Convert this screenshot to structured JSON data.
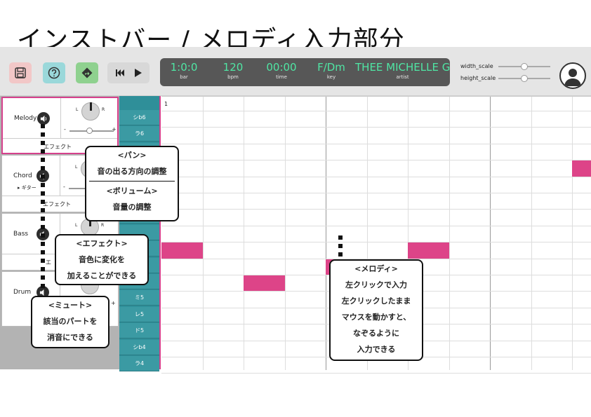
{
  "heading": "インストバー / メロディ入力部分",
  "toolbar": {
    "save_icon": "save-icon",
    "help_icon": "help-icon",
    "share_icon": "share-icon",
    "display": {
      "bar": {
        "value": "1:0:0",
        "label": "bar"
      },
      "bpm": {
        "value": "120",
        "label": "bpm"
      },
      "time": {
        "value": "00:00",
        "label": "time"
      },
      "key": {
        "value": "F/Dm",
        "label": "key"
      },
      "artist": {
        "value": "THEE MICHELLE G",
        "label": "artist"
      }
    },
    "width_scale": {
      "label": "width_scale",
      "value": 0.5
    },
    "height_scale": {
      "label": "height_scale",
      "value": 0.5
    }
  },
  "tracks": [
    {
      "name": "Melody",
      "pan_left": "L",
      "pan_right": "R",
      "minus": "-",
      "plus": "+",
      "effect": "エフェクト",
      "selected": true
    },
    {
      "name": "Chord",
      "instrument": "▸ ギター",
      "pan_left": "L",
      "minus": "-",
      "effect": "エフェクト"
    },
    {
      "name": "Bass",
      "pan_left": "L",
      "pan_right": "R",
      "effect": "エ"
    },
    {
      "name": "Drum",
      "plus": "+"
    }
  ],
  "keys": [
    "シb6",
    "ラ6",
    "",
    "",
    "",
    "",
    "",
    "",
    "",
    "",
    "",
    "ミ5",
    "レ5",
    "ド5",
    "シb4",
    "ラ4"
  ],
  "grid": {
    "bar_label": "1"
  },
  "callouts": {
    "pan": {
      "title": "<パン>",
      "lines": [
        "音の出る方向の調整"
      ]
    },
    "volume": {
      "title": "<ボリューム>",
      "lines": [
        "音量の調整"
      ]
    },
    "effect": {
      "title": "<エフェクト>",
      "lines": [
        "音色に変化を",
        "加えることができる"
      ]
    },
    "mute": {
      "title": "<ミュート>",
      "lines": [
        "該当のパートを",
        "消音にできる"
      ]
    },
    "melody": {
      "title": "<メロディ>",
      "lines": [
        "左クリックで入力",
        "左クリックしたまま",
        "マウスを動かすと、",
        "なぞるように",
        "入力できる"
      ]
    }
  },
  "colors": {
    "accent": "#dd4488",
    "keys": "#3b9aa3",
    "display_text": "#4fe6a4",
    "display_bg": "#575757"
  }
}
